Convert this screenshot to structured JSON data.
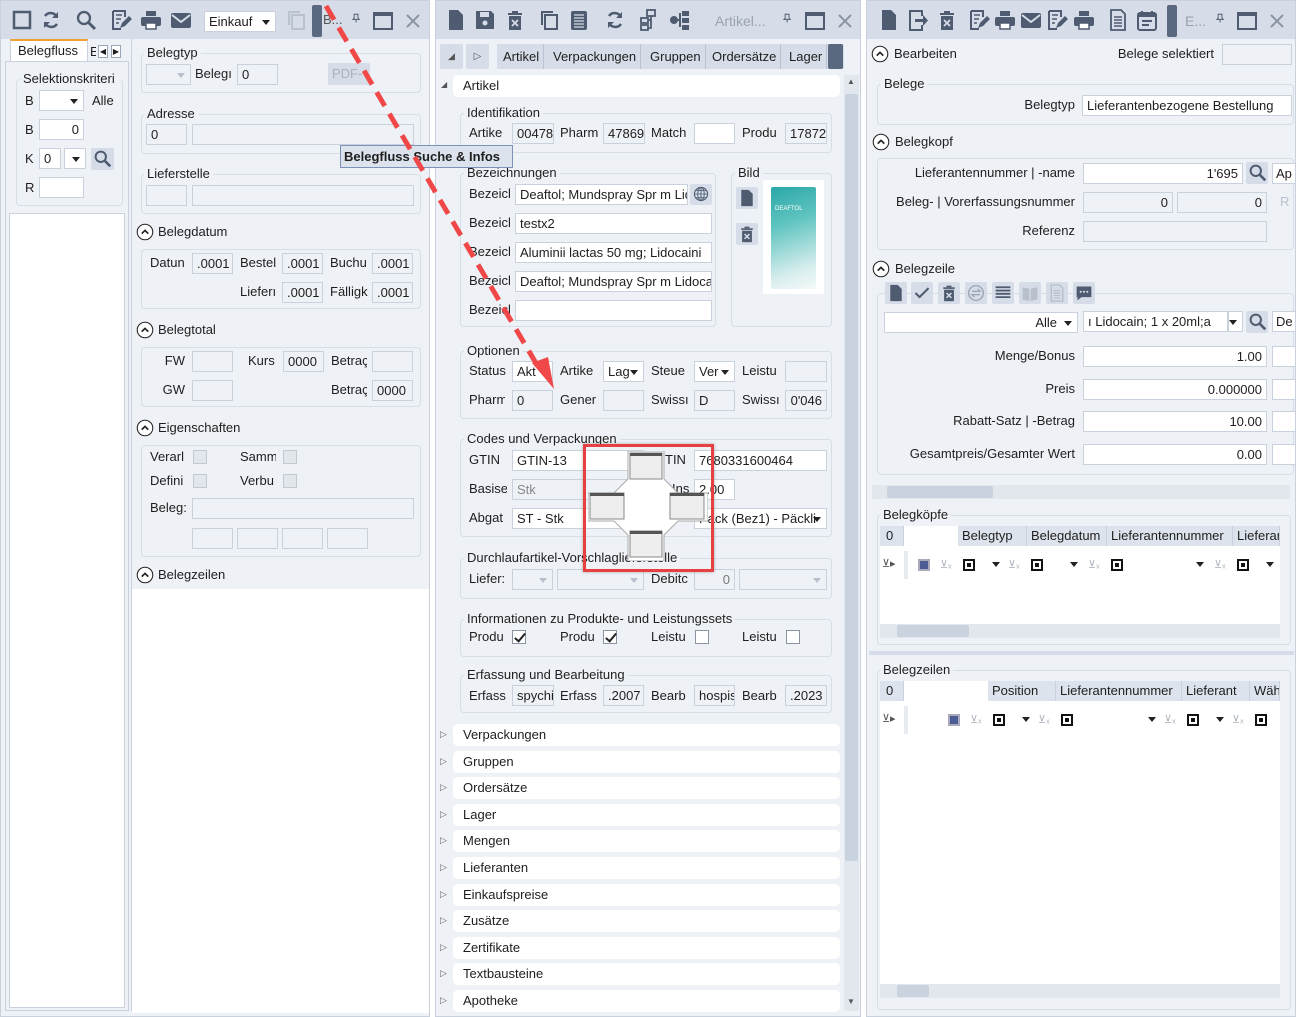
{
  "left": {
    "toolbar": {
      "select_value": "Einkauf",
      "title": "B..."
    },
    "tabs": [
      "Belegfluss",
      "E"
    ],
    "selection": {
      "title": "Selektionskriteri",
      "rows": [
        {
          "label": "B",
          "select_value": "",
          "extra": "Alle"
        },
        {
          "label": "B",
          "value": "0"
        },
        {
          "label": "K",
          "value": "0",
          "select_value": ""
        },
        {
          "label": "R",
          "value": ""
        }
      ]
    },
    "belegtyp": {
      "title": "Belegtyp",
      "number_label": "Belegı",
      "number_value": "0",
      "pdf_button": "PDF-F"
    },
    "adresse": {
      "title": "Adresse",
      "number": "0",
      "name": ""
    },
    "lieferstelle": {
      "title": "Lieferstelle"
    },
    "belegdatum": {
      "title": "Belegdatum",
      "fields": [
        {
          "label": "Datun",
          "value": ".0001"
        },
        {
          "label": "Bestel",
          "value": ".0001"
        },
        {
          "label": "Buchu",
          "value": ".0001"
        },
        {
          "label": "Lieferı",
          "value": ".0001"
        },
        {
          "label": "Fälligk",
          "value": ".0001"
        }
      ]
    },
    "belegtotal": {
      "title": "Belegtotal",
      "fw": "FW",
      "gw": "GW",
      "kurs_label": "Kurs",
      "kurs_value": "0000",
      "betrag_label": "Betraç",
      "betrag1": "",
      "betrag2": "0000"
    },
    "eigenschaften": {
      "title": "Eigenschaften",
      "verarb": "Verarl",
      "samm": "Samm",
      "defini": "Defini",
      "verbu": "Verbu",
      "beleg": "Beleg:"
    },
    "belegzeilen": {
      "title": "Belegzeilen"
    },
    "tooltip": "Belegfluss Suche & Infos"
  },
  "middle": {
    "toolbar": {
      "title": "Artikel..."
    },
    "tabs": [
      "Artikel",
      "Verpackungen",
      "Gruppen",
      "Ordersätze",
      "Lager"
    ],
    "section": "Artikel",
    "identifikation": {
      "title": "Identifikation",
      "fields": [
        {
          "label": "Artike",
          "value": "00478"
        },
        {
          "label": "Pharm",
          "value": "47869"
        },
        {
          "label": "Match",
          "value": ""
        },
        {
          "label": "Produ",
          "value": "17872"
        }
      ]
    },
    "bezeichnungen": {
      "title": "Bezeichnungen",
      "label": "Bezeicl",
      "values": [
        "Deaftol; Mundspray Spr m Lidocain",
        "testx2",
        "Aluminii lactas 50 mg; Lidocaini",
        "Deaftol; Mundspray Spr m Lidocain",
        ""
      ]
    },
    "bild": {
      "title": "Bild",
      "product_text": "DEAFTOL"
    },
    "optionen": {
      "title": "Optionen",
      "status_label": "Status",
      "status": "Akt",
      "artikel_label": "Artike",
      "artikel": "Lag",
      "steuer_label": "Steue",
      "steuer": "Ver",
      "leistu_label": "Leistu",
      "leistu": "",
      "pharm_label": "Pharm",
      "pharm": "0",
      "gener_label": "Gener",
      "gener": "",
      "swiss1_label": "Swissı",
      "swiss1": "D",
      "swiss2_label": "Swissı",
      "swiss2": "0'046"
    },
    "codes": {
      "title": "Codes und Verpackungen",
      "gtin_label": "GTIN",
      "gtin_type": "GTIN-13",
      "gtin2_label": "TIN",
      "gtin": "7680331600464",
      "basis_label": "Basise",
      "basis": "Stk",
      "ins_label": "Ins",
      "ins": "2.00",
      "abgabe_label": "Abgat",
      "abgabe": "ST - Stk",
      "pack": "Pack (Bez1) - Päckli"
    },
    "durchlauf": {
      "title": "Durchlaufartikel-Vorschlaglieferstelle",
      "liefer_label": "Liefer:",
      "debitor_label": "Debitc",
      "debitor": "0"
    },
    "info": {
      "title": "Informationen zu Produkte- und Leistungssets",
      "items": [
        {
          "label": "Produ",
          "checked": true
        },
        {
          "label": "Produ",
          "checked": true
        },
        {
          "label": "Leistu",
          "checked": false
        },
        {
          "label": "Leistu",
          "checked": false
        }
      ]
    },
    "erfassung": {
      "title": "Erfassung und Bearbeitung",
      "fields": [
        {
          "label": "Erfass",
          "value": "spychi"
        },
        {
          "label": "Erfass",
          "value": ".2007"
        },
        {
          "label": "Bearb",
          "value": "hospis"
        },
        {
          "label": "Bearb",
          "value": ".2023"
        }
      ]
    },
    "accordion": [
      "Verpackungen",
      "Gruppen",
      "Ordersätze",
      "Lager",
      "Mengen",
      "Lieferanten",
      "Einkaufspreise",
      "Zusätze",
      "Zertifikate",
      "Textbausteine",
      "Apotheke"
    ]
  },
  "right": {
    "toolbar": {
      "title": "E..."
    },
    "bearbeiten": {
      "title": "Bearbeiten",
      "selected_label": "Belege selektiert",
      "selected_value": ""
    },
    "belege": {
      "title": "Belege",
      "belegtyp_label": "Belegtyp",
      "belegtyp": "Lieferantenbezogene Bestellung"
    },
    "belegkopf": {
      "title": "Belegkopf",
      "lief_label": "Lieferantennummer | -name",
      "lief_nr": "1'695",
      "lief_name": "Ap",
      "beleg_label": "Beleg- | Vorerfassungsnummer",
      "beleg_nr": "0",
      "vorerf_nr": "0",
      "r_button": "R",
      "referenz_label": "Referenz",
      "referenz": ""
    },
    "belegzeile": {
      "title": "Belegzeile",
      "filter": "Alle",
      "article": "ı Lidocain; 1 x 20ml;a",
      "de": "De",
      "rows": [
        {
          "label": "Menge/Bonus",
          "value": "1.00"
        },
        {
          "label": "Preis",
          "value": "0.000000"
        },
        {
          "label": "Rabatt-Satz | -Betrag",
          "value": "10.00"
        },
        {
          "label": "Gesamtpreis/Gesamter Wert",
          "value": "0.00"
        }
      ]
    },
    "belegkoepfe": {
      "title": "Belegköpfe",
      "count": "0",
      "columns": [
        "Belegtyp",
        "Belegdatum",
        "Lieferantennummer",
        "Lieferant"
      ]
    },
    "belegzeilen": {
      "title": "Belegzeilen",
      "count": "0",
      "columns": [
        "Position",
        "Lieferantennummer",
        "Lieferant",
        "Wäh"
      ]
    }
  },
  "colors": {
    "toolbar": "#d6dde8",
    "panel": "#eef1f6",
    "accent_tab": "#f0a030",
    "dock_highlight": "#e84040",
    "arrow": "#f04848"
  }
}
